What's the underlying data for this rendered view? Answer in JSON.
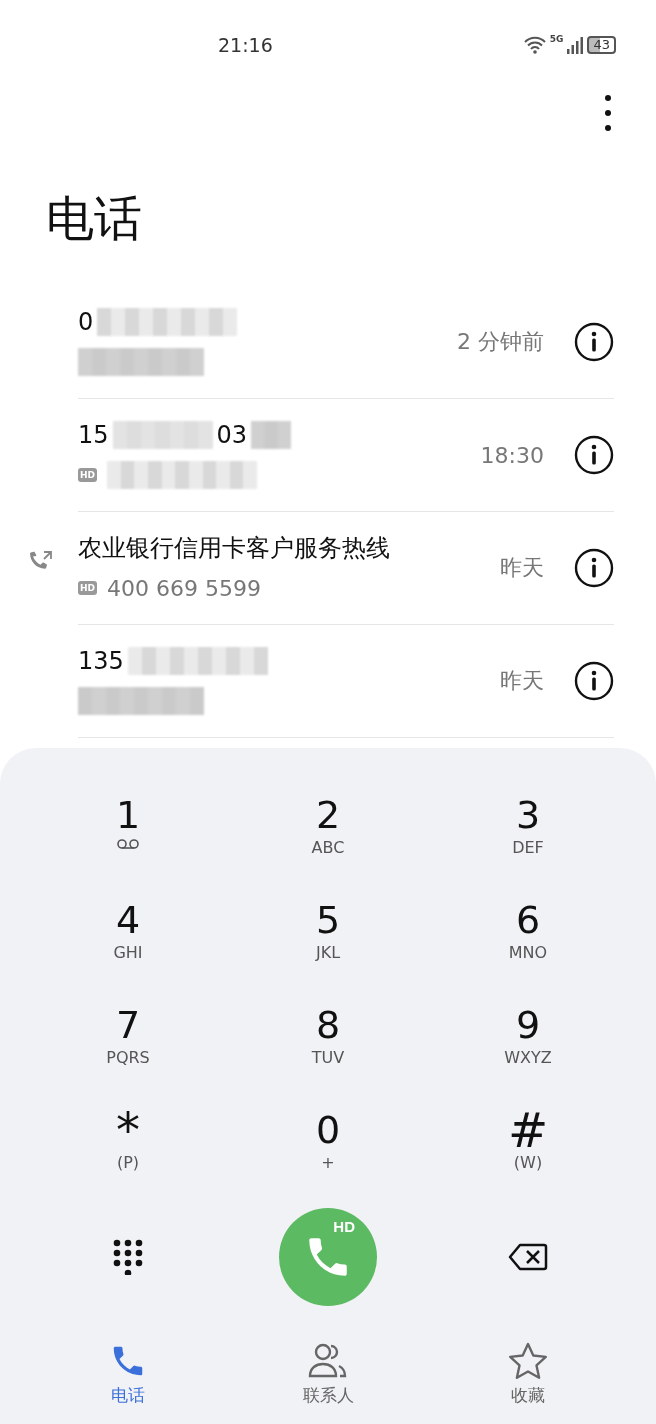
{
  "status_bar": {
    "time": "21:16",
    "network": "5G",
    "battery": "43"
  },
  "title": "电话",
  "calls": [
    {
      "kind": "redacted",
      "name_segments": [
        "0"
      ],
      "time": "2 分钟前",
      "call_icon": false
    },
    {
      "kind": "redacted",
      "name_segments": [
        "15",
        "03"
      ],
      "hd_badge": "HD",
      "time": "18:30",
      "call_icon": false
    },
    {
      "kind": "plain",
      "name_segments": [
        "农业银行信用卡客户服务热线"
      ],
      "hd_badge": "HD",
      "number": "400 669 5599",
      "time": "昨天",
      "call_icon": true
    },
    {
      "kind": "redacted",
      "name_segments": [
        "135"
      ],
      "time": "昨天",
      "call_icon": false
    }
  ],
  "keypad": [
    {
      "digit": "1",
      "kind": "voicemail"
    },
    {
      "digit": "2",
      "letters": "ABC",
      "kind": "letters"
    },
    {
      "digit": "3",
      "letters": "DEF",
      "kind": "letters"
    },
    {
      "digit": "4",
      "letters": "GHI",
      "kind": "letters"
    },
    {
      "digit": "5",
      "letters": "JKL",
      "kind": "letters"
    },
    {
      "digit": "6",
      "letters": "MNO",
      "kind": "letters"
    },
    {
      "digit": "7",
      "letters": "PQRS",
      "kind": "letters"
    },
    {
      "digit": "8",
      "letters": "TUV",
      "kind": "letters"
    },
    {
      "digit": "9",
      "letters": "WXYZ",
      "kind": "letters"
    },
    {
      "digit": "*",
      "letters": "(P)",
      "kind": "letters"
    },
    {
      "digit": "0",
      "letters": "+",
      "kind": "letters"
    },
    {
      "digit": "#",
      "letters": "(W)",
      "kind": "letters"
    }
  ],
  "call_button": {
    "badge": "HD"
  },
  "tabs": [
    {
      "label": "电话",
      "selected": true
    },
    {
      "label": "联系人",
      "selected": false
    },
    {
      "label": "收藏",
      "selected": false
    }
  ]
}
